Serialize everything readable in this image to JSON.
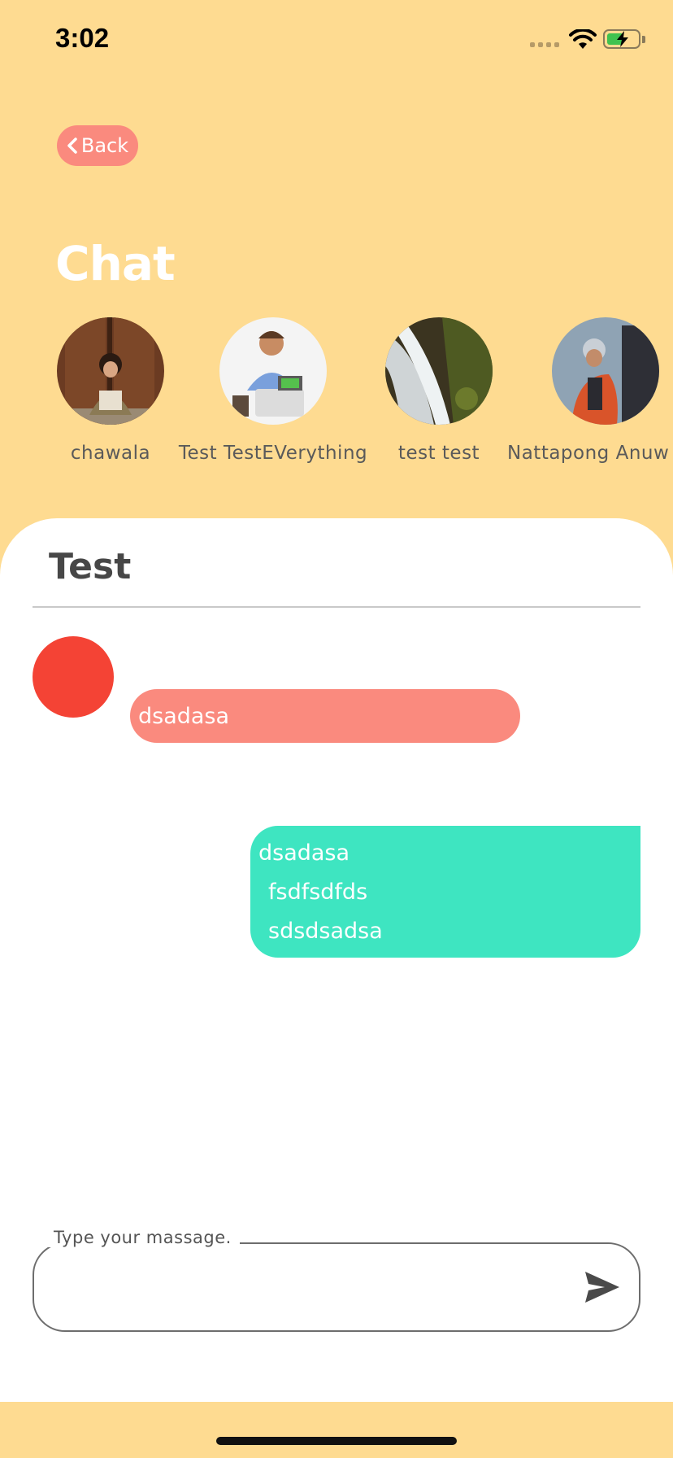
{
  "status_bar": {
    "time": "3:02"
  },
  "header": {
    "back_label": "Back",
    "title": "Chat"
  },
  "contacts": [
    {
      "name": "chawala"
    },
    {
      "name": "Test TestEVerything"
    },
    {
      "name": "test test"
    },
    {
      "name": "Nattapong Anuw"
    }
  ],
  "chat": {
    "title": "Test",
    "incoming": {
      "text": "dsadasa",
      "bubble_color": "#FA8A7E",
      "avatar_color": "#F44335"
    },
    "outgoing": {
      "lines": [
        "dsadasa",
        "fsdfsdfds",
        "sdsdsadsa"
      ],
      "bubble_color": "#3EE5C1"
    }
  },
  "composer": {
    "label": "Type your massage.",
    "value": "",
    "send_icon": "send-icon"
  },
  "colors": {
    "background": "#FEDB91",
    "accent": "#FA8A7E"
  }
}
